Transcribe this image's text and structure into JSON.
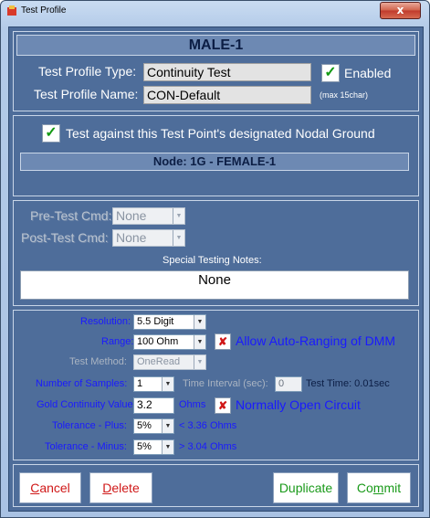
{
  "window": {
    "title": "Test Profile",
    "close_glyph": "x"
  },
  "header": {
    "name": "MALE-1"
  },
  "profile": {
    "type_label": "Test Profile Type:",
    "type_value": "Continuity Test",
    "enabled_label": "Enabled",
    "name_label": "Test Profile Name:",
    "name_value": "CON-Default",
    "name_hint": "(max 15char)"
  },
  "ground": {
    "label": "Test against this Test Point's designated Nodal Ground",
    "node": "Node: 1G - FEMALE-1"
  },
  "cmds": {
    "pre_label": "Pre-Test Cmd:",
    "pre_value": "None",
    "post_label": "Post-Test Cmd:",
    "post_value": "None",
    "notes_label": "Special Testing Notes:",
    "notes_value": "None"
  },
  "settings": {
    "resolution_label": "Resolution:",
    "resolution_value": "5.5 Digit",
    "range_label": "Range:",
    "range_value": "100 Ohm",
    "autorange_label": "Allow Auto-Ranging of DMM",
    "method_label": "Test Method:",
    "method_value": "OneRead",
    "samples_label": "Number of Samples:",
    "samples_value": "1",
    "interval_label": "Time Interval (sec):",
    "interval_value": "0",
    "test_time": "Test Time: 0.01sec",
    "gold_label": "Gold Continuity Value:",
    "gold_value": "3.2",
    "gold_unit": "Ohms",
    "normally_open_label": "Normally Open Circuit",
    "tol_plus_label": "Tolerance - Plus:",
    "tol_plus_value": "5%",
    "tol_plus_result": "< 3.36 Ohms",
    "tol_minus_label": "Tolerance - Minus:",
    "tol_minus_value": "5%",
    "tol_minus_result": "> 3.04 Ohms"
  },
  "buttons": {
    "cancel_first": "C",
    "cancel_rest": "ancel",
    "delete_first": "D",
    "delete_rest": "elete",
    "duplicate": "Duplicate",
    "commit_start": "Co",
    "commit_u": "m",
    "commit_end": "mit"
  },
  "icons": {
    "check": "✓",
    "cross": "✘",
    "dropdown": "▼"
  },
  "colors": {
    "panel": "#4e6d9a",
    "link_blue": "#1a1aff",
    "danger": "#d01818",
    "success": "#1a9a1a"
  }
}
